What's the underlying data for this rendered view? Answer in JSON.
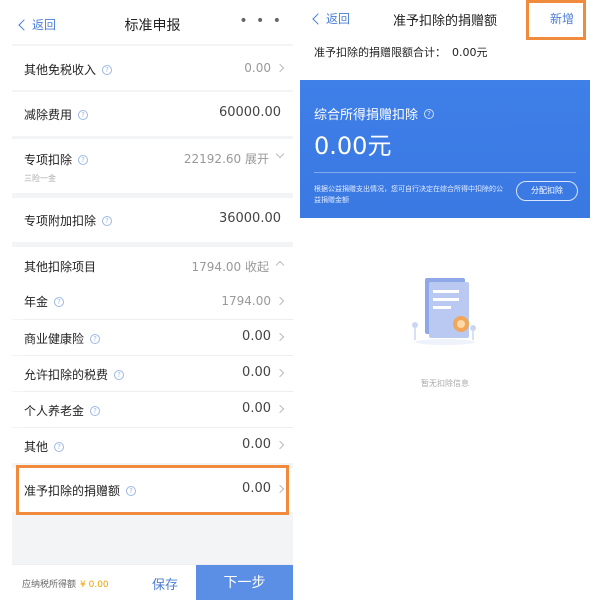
{
  "left": {
    "nav": {
      "back": "返回",
      "title": "标准申报",
      "more": "• • •"
    },
    "rows": {
      "tax_free_income": {
        "label": "其他免税收入",
        "value": "0.00"
      },
      "deduction_fee": {
        "label": "减除费用",
        "value": "60000.00"
      },
      "special": {
        "label": "专项扣除",
        "value": "22192.60",
        "action": "展开",
        "sub": "三险一金"
      },
      "special_additional": {
        "label": "专项附加扣除",
        "value": "36000.00"
      },
      "other_items": {
        "label": "其他扣除项目",
        "value": "1794.00",
        "action": "收起"
      },
      "annuity": {
        "label": "年金",
        "value": "1794.00"
      },
      "health": {
        "label": "商业健康险",
        "value": "0.00"
      },
      "tax_fee": {
        "label": "允许扣除的税费",
        "value": "0.00"
      },
      "pension": {
        "label": "个人养老金",
        "value": "0.00"
      },
      "other": {
        "label": "其他",
        "value": "0.00"
      },
      "donation": {
        "label": "准予扣除的捐赠额",
        "value": "0.00"
      }
    },
    "footer": {
      "taxable_label": "应纳税所得额",
      "taxable_value": "¥ 0.00",
      "save": "保存",
      "next": "下一步"
    }
  },
  "right": {
    "nav": {
      "back": "返回",
      "title": "准予扣除的捐赠额",
      "add": "新增"
    },
    "limit_label": "准予扣除的捐赠限额合计：",
    "limit_value": "0.00元",
    "card": {
      "title": "综合所得捐赠扣除",
      "amount": "0.00元",
      "note": "根据公益捐赠支出情况，您可自行决定在综合所得中扣除的公益捐赠金额",
      "button": "分配扣除"
    },
    "empty_text": "暂无扣除信息"
  },
  "colors": {
    "accent": "#4a7ed9",
    "highlight": "#f08a3c",
    "card_blue": "#3f7fe8",
    "next_button": "#5b8fe6",
    "tax_value": "#f0a200"
  }
}
